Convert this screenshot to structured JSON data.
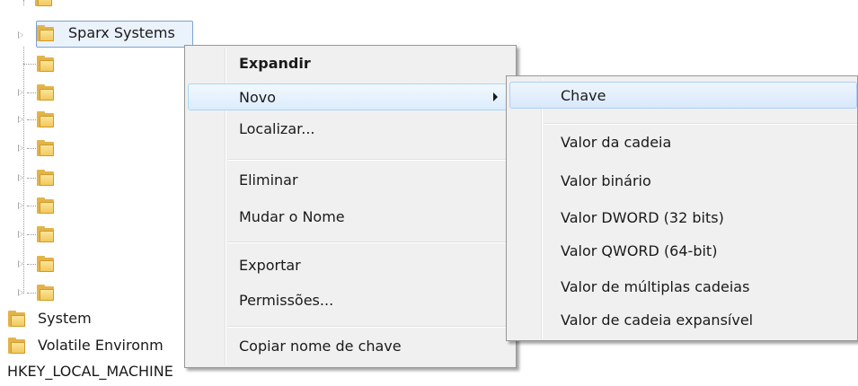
{
  "tree": {
    "selected_key": "Sparx Systems",
    "keys_below": [
      "System",
      "Volatile Environm"
    ]
  },
  "statusbar": {
    "path": "HKEY_LOCAL_MACHINE"
  },
  "context_menu": {
    "items": {
      "expand": "Expandir",
      "new": "Novo",
      "find": "Localizar...",
      "delete": "Eliminar",
      "rename": "Mudar o Nome",
      "export": "Exportar",
      "permissions": "Permissões...",
      "copy_key_name": "Copiar nome de chave"
    }
  },
  "submenu_new": {
    "items": {
      "key": "Chave",
      "string_value": "Valor da cadeia",
      "binary_value": "Valor binário",
      "dword_value": "Valor DWORD (32 bits)",
      "qword_value": "Valor QWORD (64-bit)",
      "multi_string_value": "Valor de múltiplas cadeias",
      "expandable_string_value": "Valor de cadeia expansível"
    }
  }
}
